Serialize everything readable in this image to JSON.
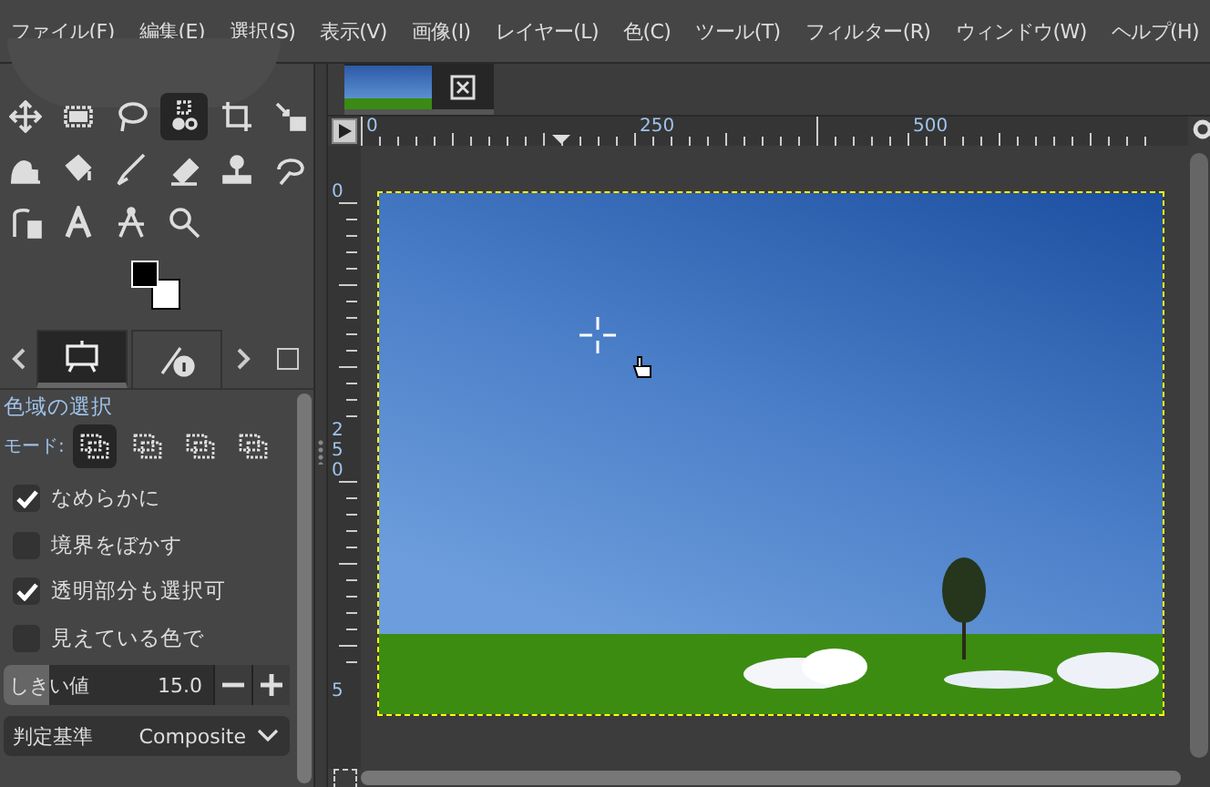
{
  "menu": [
    "ファイル(F)",
    "編集(E)",
    "選択(S)",
    "表示(V)",
    "画像(I)",
    "レイヤー(L)",
    "色(C)",
    "ツール(T)",
    "フィルター(R)",
    "ウィンドウ(W)",
    "ヘルプ(H)"
  ],
  "tools": [
    {
      "kind": "move",
      "selected": false
    },
    {
      "kind": "rect",
      "selected": false
    },
    {
      "kind": "lasso",
      "selected": false
    },
    {
      "kind": "fuzzy",
      "selected": true
    },
    {
      "kind": "crop",
      "selected": false
    },
    {
      "kind": "scale",
      "selected": false
    },
    {
      "kind": "warp",
      "selected": false
    },
    {
      "kind": "bucket",
      "selected": false
    },
    {
      "kind": "brush",
      "selected": false
    },
    {
      "kind": "eraser",
      "selected": false
    },
    {
      "kind": "stamp",
      "selected": false
    },
    {
      "kind": "smudge",
      "selected": false
    },
    {
      "kind": "path",
      "selected": false
    },
    {
      "kind": "text",
      "selected": false
    },
    {
      "kind": "measure",
      "selected": false
    },
    {
      "kind": "zoom",
      "selected": false
    }
  ],
  "panel_tabs": [
    {
      "kind": "options",
      "selected": true
    },
    {
      "kind": "info",
      "selected": false
    }
  ],
  "tool_options": {
    "title": "色域の選択",
    "mode_label": "モード:",
    "modes": [
      {
        "selected": true
      },
      {
        "selected": false
      },
      {
        "selected": false
      },
      {
        "selected": false
      }
    ],
    "checkboxes": [
      {
        "label": "なめらかに",
        "checked": true
      },
      {
        "label": "境界をぼかす",
        "checked": false
      },
      {
        "label": "透明部分も選択可",
        "checked": true
      },
      {
        "label": "見えている色で",
        "checked": false
      }
    ],
    "threshold": {
      "label": "しきい値",
      "value": "15.0",
      "level": 0.16
    },
    "criterion": {
      "label": "判定基準",
      "value": "Composite"
    }
  },
  "rulers": {
    "horizontal": [
      "0",
      "250",
      "500"
    ],
    "vertical": [
      "0",
      "250",
      "5"
    ]
  }
}
